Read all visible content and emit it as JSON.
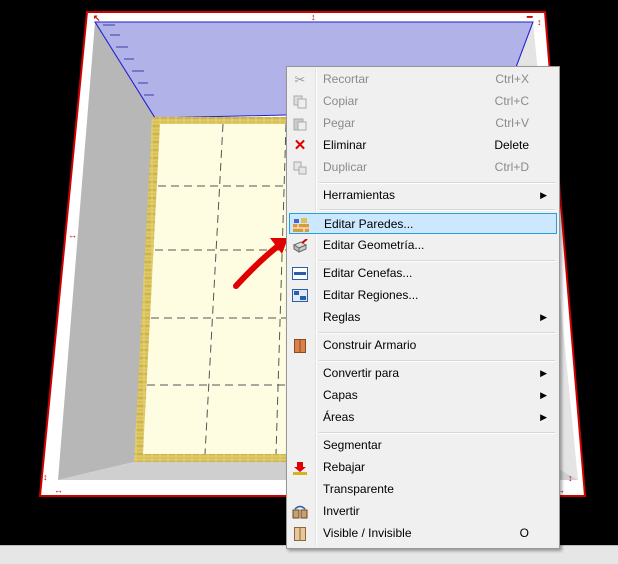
{
  "menu": {
    "items": [
      {
        "label": "Recortar",
        "shortcut": "Ctrl+X",
        "icon": "scissors-icon",
        "disabled": true
      },
      {
        "label": "Copiar",
        "shortcut": "Ctrl+C",
        "icon": "copy-icon",
        "disabled": true
      },
      {
        "label": "Pegar",
        "shortcut": "Ctrl+V",
        "icon": "paste-icon",
        "disabled": true
      },
      {
        "label": "Eliminar",
        "shortcut": "Delete",
        "icon": "delete-x-icon",
        "disabled": false
      },
      {
        "label": "Duplicar",
        "shortcut": "Ctrl+D",
        "icon": "duplicate-icon",
        "disabled": true
      },
      {
        "label": "Herramientas",
        "submenu": true
      },
      {
        "label": "Editar Paredes...",
        "icon": "brick-wall-icon",
        "highlighted": true
      },
      {
        "label": "Editar Geometría...",
        "icon": "geometry-box-icon"
      },
      {
        "label": "Editar Cenefas...",
        "icon": "border-strip-icon"
      },
      {
        "label": "Editar Regiones...",
        "icon": "regions-icon"
      },
      {
        "label": "Reglas",
        "submenu": true
      },
      {
        "label": "Construir Armario",
        "icon": "cabinet-icon"
      },
      {
        "label": "Convertir para",
        "submenu": true
      },
      {
        "label": "Capas",
        "submenu": true
      },
      {
        "label": "Áreas",
        "submenu": true
      },
      {
        "label": "Segmentar"
      },
      {
        "label": "Rebajar",
        "icon": "lower-arrow-icon"
      },
      {
        "label": "Transparente"
      },
      {
        "label": "Invertir",
        "icon": "invert-icon"
      },
      {
        "label": "Visible / Invisible",
        "shortcut": "O",
        "icon": "visibility-icon"
      }
    ]
  },
  "colors": {
    "ceiling": "#b0b2e8",
    "floor": "#fffde1",
    "wall_left": "#b7b7b7",
    "wall_right": "#e4e4e4",
    "tile_border": "#d3c05a",
    "selection": "#e00000",
    "highlight_bg": "#cce8ff",
    "highlight_border": "#26a0da",
    "annotation_arrow": "#e00000"
  }
}
